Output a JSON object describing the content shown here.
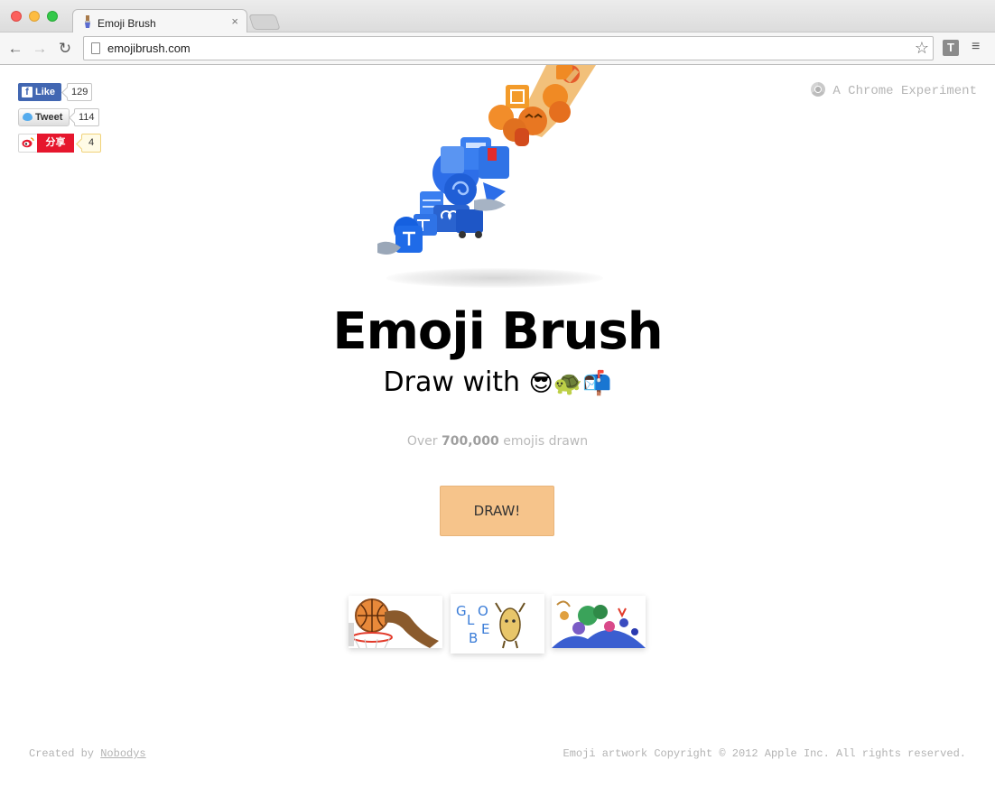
{
  "browser": {
    "tab_title": "Emoji Brush",
    "tab_close": "×",
    "url": "emojibrush.com",
    "nav": {
      "back": "←",
      "forward": "→",
      "reload": "↻"
    },
    "star": "☆",
    "extension_label": "T",
    "menu": "≡"
  },
  "social": {
    "facebook": {
      "icon_letter": "f",
      "label": "Like",
      "count": "129"
    },
    "twitter": {
      "label": "Tweet",
      "count": "114"
    },
    "weibo": {
      "label": "分享",
      "count": "4"
    }
  },
  "chrome_experiment": {
    "label": "A Chrome Experiment"
  },
  "hero": {
    "title": "Emoji Brush",
    "subtitle_prefix": "Draw with",
    "subtitle_emojis": "😎🐢📬"
  },
  "stats": {
    "prefix": "Over",
    "count": "700,000",
    "suffix": "emojis drawn"
  },
  "cta": {
    "draw_label": "DRAW!"
  },
  "gallery": {
    "thumb_1": "G",
    "thumb_2": "L",
    "thumb_3": "O",
    "thumb_4": "B",
    "thumb_5": "E"
  },
  "footer": {
    "created_by_prefix": "Created by",
    "created_by_link": "Nobodys",
    "copyright": "Emoji artwork Copyright © 2012 Apple Inc. All rights reserved."
  },
  "colors": {
    "facebook_blue": "#4267b2",
    "weibo_red": "#e6162d",
    "draw_button": "#f6c48b"
  }
}
